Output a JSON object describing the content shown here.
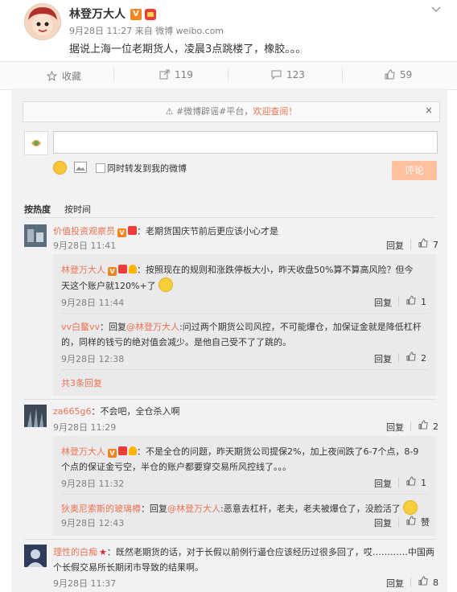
{
  "post": {
    "author": "林登万大人",
    "verified_badge": "V",
    "time": "9月28日 11:27 来自 微博 weibo.com",
    "content": "据说上海一位老期货人，凌晨3点跳楼了，橡胶。。。"
  },
  "actions": {
    "favorite": "收藏",
    "repost": "119",
    "comment": "123",
    "like": "59"
  },
  "notice": {
    "prefix": "#微博辟谣#平台，",
    "link": "欢迎查阅！",
    "close": "×"
  },
  "composer": {
    "checkbox_label": "同时转发到我的微博",
    "submit": "评论"
  },
  "sort": {
    "hot": "按热度",
    "time": "按时间"
  },
  "comments": [
    {
      "user": "价值投资观察员",
      "badge": "V",
      "text": "：老期货国庆节前后更应该小心才是",
      "time": "9月28日 11:41",
      "reply": "回复",
      "likes": "7",
      "sub": [
        {
          "user": "林登万大人",
          "badge": "V",
          "text_line1": "：按照现在的规则和涨跌停板大小，昨天收盘50%算不算高风险？但今",
          "text_line2": "天这个账户就120%+了",
          "time": "9月28日 11:44",
          "reply": "回复",
          "likes": "1"
        },
        {
          "user": "vv白鳌vv",
          "text_prefix": "：回复",
          "mention": "@林登万大人",
          "text_line1": ":问过两个期货公司风控，不可能爆仓，加保证金就是降低杠杆",
          "text_line2": "的，同样的钱亏的绝对值会减少。是他自己受不了了跳的。",
          "time": "9月28日 12:38",
          "reply": "回复",
          "likes": "2"
        }
      ],
      "more": "共3条回复"
    },
    {
      "user": "za665g6",
      "text": "：不会吧，全仓杀入啊",
      "time": "9月28日 11:29",
      "reply": "回复",
      "likes": "2",
      "sub": [
        {
          "user": "林登万大人",
          "badge": "V",
          "text_line1": "：不是全仓的问题，昨天期货公司提保2%，加上夜间跌了6-7个点，8-9",
          "text_line2": "个点的保证金亏空，半仓的账户都要穿交易所风控线了。。。",
          "time": "9月28日 11:32",
          "reply": "回复",
          "likes": "1"
        },
        {
          "user": "狄奥尼索斯的玻璃樽",
          "text_prefix": "：回复",
          "mention": "@林登万大人",
          "text_line1": ":恶意去杠杆，老夫，老夫被爆仓了，没脸活了",
          "time": "9月28日 12:43",
          "reply": "回复",
          "likes": "赞"
        }
      ]
    },
    {
      "user": "理性的白痴",
      "text_line1": "：既然老期货的话，对于长假以前例行逼仓应该经历过很多回了，哎…………中国两",
      "text_line2": "个长假交易所长期闭市导致的结果啊。",
      "time": "9月28日 11:37",
      "reply": "回复",
      "likes": "8"
    }
  ],
  "colors": {
    "accent": "#eb7350",
    "muted": "#808080",
    "panel": "#f2f2f5",
    "sub_panel": "#eaeaec",
    "submit_disabled": "#ffc09f"
  }
}
